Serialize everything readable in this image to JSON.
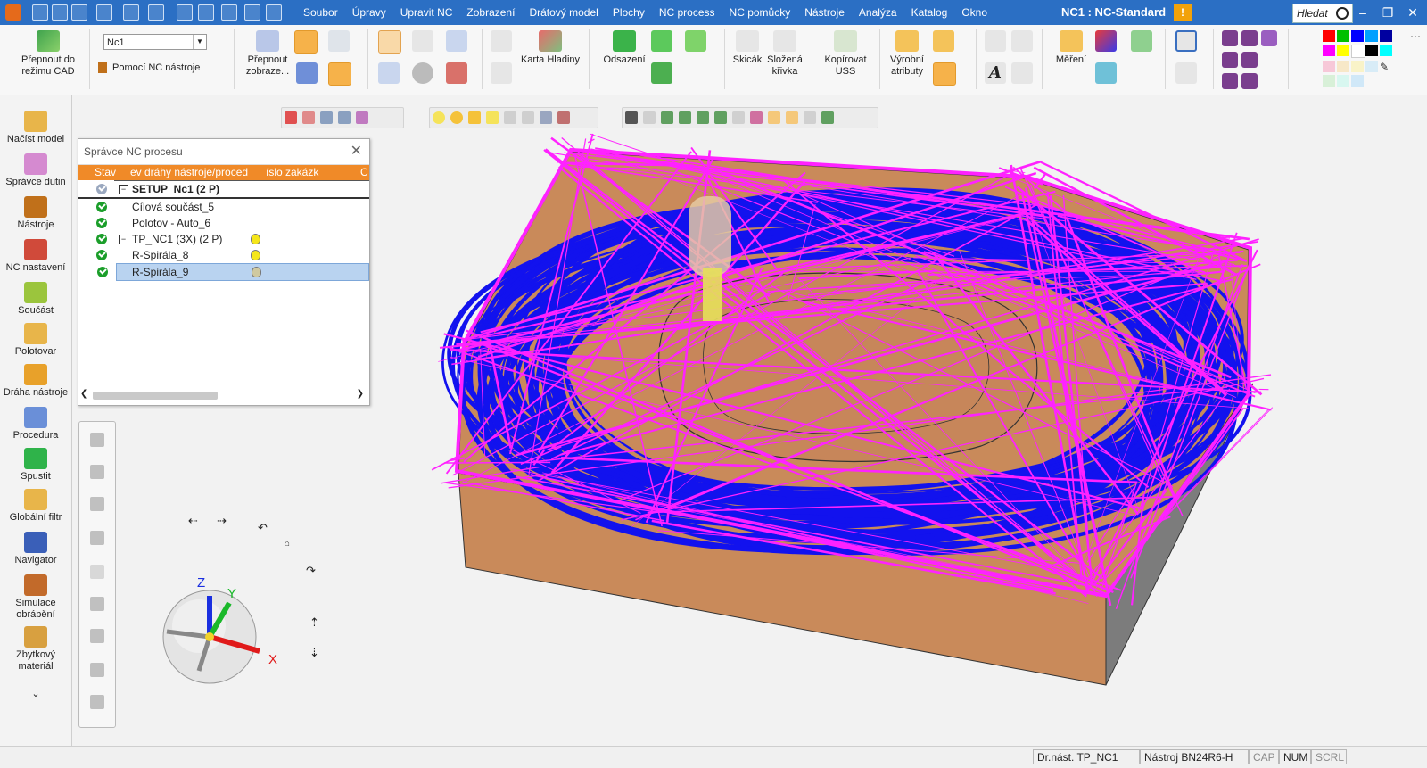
{
  "window": {
    "title": "NC1 : NC-Standard",
    "warning_badge": "!",
    "search_placeholder": "Hledat"
  },
  "menu": [
    "Soubor",
    "Úpravy",
    "Upravit NC",
    "Zobrazení",
    "Drátový model",
    "Plochy",
    "NC process",
    "NC pomůcky",
    "Nástroje",
    "Analýza",
    "Katalog",
    "Okno"
  ],
  "ribbon": {
    "switch_cad": "Přepnout do režimu CAD",
    "nc_combo": "Nc1",
    "nc_tool_help": "Pomocí NC nástroje",
    "switch_view": "Přepnout zobraze...",
    "layers_card": "Karta Hladiny",
    "offset": "Odsazení",
    "sketch": "Skicák",
    "composite_curve": "Složená křivka",
    "copy_uss": "Kopírovat USS",
    "prod_attributes": "Výrobní atributy",
    "measure": "Měření"
  },
  "palette_colors": [
    "#ff0000",
    "#00c000",
    "#0000ff",
    "#00a0ff",
    "#0000a0",
    "#ff00ff",
    "#ffff00",
    "#ffffff",
    "#000000",
    "#00ffff"
  ],
  "left_toolbar": [
    {
      "name": "load-model",
      "label": "Načíst model",
      "color": "#e8b54a"
    },
    {
      "name": "mold-manager",
      "label": "Správce dutin",
      "color": "#d58ad0"
    },
    {
      "name": "tools",
      "label": "Nástroje",
      "color": "#c0701a"
    },
    {
      "name": "nc-settings",
      "label": "NC nastavení",
      "color": "#d04a3a"
    },
    {
      "name": "part",
      "label": "Součást",
      "color": "#9bc53d"
    },
    {
      "name": "stock",
      "label": "Polotovar",
      "color": "#e8b54a"
    },
    {
      "name": "toolpath",
      "label": "Dráha nástroje",
      "color": "#e8a12a"
    },
    {
      "name": "procedure",
      "label": "Procedura",
      "color": "#6a8fd8"
    },
    {
      "name": "run",
      "label": "Spustit",
      "color": "#2fb34a"
    },
    {
      "name": "global-filter",
      "label": "Globální filtr",
      "color": "#e8b54a"
    },
    {
      "name": "navigator",
      "label": "Navigator",
      "color": "#3a5fb8"
    },
    {
      "name": "machining-sim",
      "label": "Simulace obrábění",
      "color": "#c26a2a"
    },
    {
      "name": "rest-material",
      "label": "Zbytkový materiál",
      "color": "#d8a040"
    }
  ],
  "nc_manager": {
    "title": "Správce NC procesu",
    "columns": [
      "Stav",
      "ev dráhy nástroje/proced",
      "íslo zakázk",
      "C"
    ],
    "rows": [
      {
        "text": "SETUP_Nc1 (2 P)",
        "level": 0,
        "bold": true,
        "expander": "−"
      },
      {
        "text": "Cílová součást_5",
        "level": 1
      },
      {
        "text": "Polotov - Auto_6",
        "level": 1
      },
      {
        "text": "TP_NC1 (3X) (2 P)",
        "level": 0,
        "expander": "−",
        "bulb": true
      },
      {
        "text": "R-Spirála_8",
        "level": 1,
        "bulb": true
      },
      {
        "text": "R-Spirála_9",
        "level": 1,
        "bulb": true,
        "selected": true
      }
    ]
  },
  "axes": {
    "x": "X",
    "y": "Y",
    "z": "Z"
  },
  "status": {
    "drawing_layer": "Dr.nást. TP_NC1",
    "tool": "Nástroj BN24R6-H",
    "cap": "CAP",
    "num": "NUM",
    "scrl": "SCRL"
  }
}
